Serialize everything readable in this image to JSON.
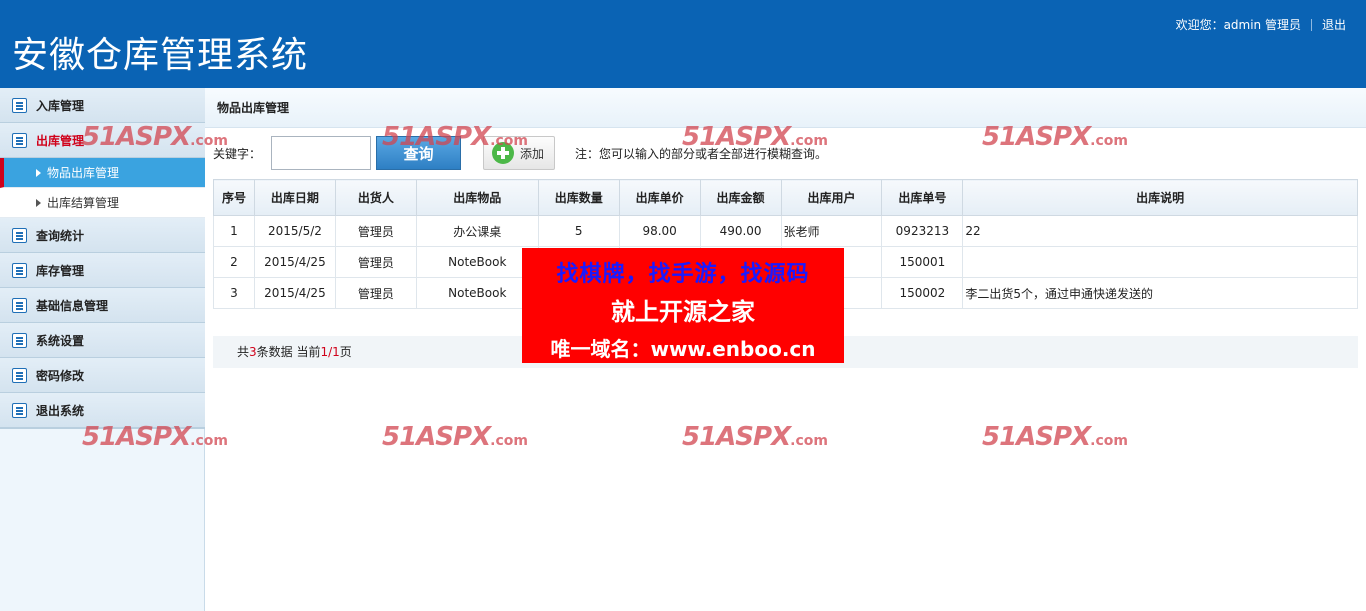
{
  "header": {
    "title": "安徽仓库管理系统",
    "welcome": "欢迎您：admin 管理员",
    "logout": "退出"
  },
  "sidebar": {
    "items": [
      {
        "label": "入库管理",
        "icon": "list-icon"
      },
      {
        "label": "出库管理",
        "icon": "list-icon",
        "expanded": true,
        "children": [
          {
            "label": "物品出库管理",
            "active": true
          },
          {
            "label": "出库结算管理",
            "active": false
          }
        ]
      },
      {
        "label": "查询统计",
        "icon": "list-icon"
      },
      {
        "label": "库存管理",
        "icon": "list-icon"
      },
      {
        "label": "基础信息管理",
        "icon": "list-icon"
      },
      {
        "label": "系统设置",
        "icon": "list-icon"
      },
      {
        "label": "密码修改",
        "icon": "list-icon"
      },
      {
        "label": "退出系统",
        "icon": "list-icon"
      }
    ]
  },
  "main": {
    "breadcrumb": "物品出库管理",
    "search": {
      "label": "关键字：",
      "value": "",
      "query_label": "查询",
      "add_label": "添加",
      "note": "注：您可以输入的部分或者全部进行模糊查询。"
    },
    "table": {
      "columns": [
        "序号",
        "出库日期",
        "出货人",
        "出库物品",
        "出库数量",
        "出库单价",
        "出库金额",
        "出库用户",
        "出库单号",
        "出库说明"
      ],
      "rows": [
        [
          "1",
          "2015/5/2",
          "管理员",
          "办公课桌",
          "5",
          "98.00",
          "490.00",
          "张老师",
          "0923213",
          "22"
        ],
        [
          "2",
          "2015/4/25",
          "管理员",
          "NoteBook",
          "",
          "",
          "",
          "",
          "150001",
          ""
        ],
        [
          "3",
          "2015/4/25",
          "管理员",
          "NoteBook",
          "",
          "",
          "",
          "",
          "150002",
          "李二出货5个，通过申通快递发送的"
        ]
      ]
    },
    "pager": {
      "prefix": "共",
      "count": "3",
      "mid": "条数据 当前",
      "page": "1/1",
      "suffix": "页"
    }
  },
  "watermark": {
    "text": "51ASPX",
    "domain": ".com"
  },
  "ad": {
    "line1": "找棋牌，找手游，找源码",
    "line2": "就上开源之家",
    "line3": "唯一域名：www.enboo.cn"
  },
  "colors": {
    "header_bg": "#0a63b4",
    "active_sub_bg": "#3aa3e0",
    "accent_red": "#d0021b",
    "ad_bg": "#ff0000",
    "ad_blue": "#1a1aff"
  }
}
